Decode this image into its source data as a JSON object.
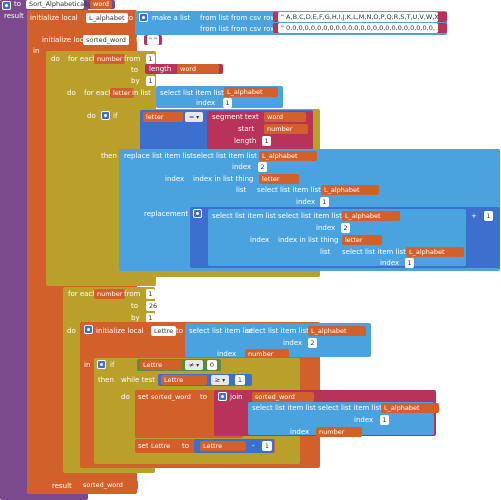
{
  "proc": {
    "to": "to",
    "name": "Sort_Alphabetically",
    "param": "word",
    "result": "result"
  },
  "init1": {
    "label": "initialize local",
    "var1": "L_alphabet",
    "to": "to",
    "make_list": "make a list",
    "from_csv": "from list from csv row  text",
    "csv_letters": "\" A,B,C,D,E,F,G,H,I,J,K,L,M,N,O,P,Q,R,S,T,U,V,W,X, ... \"",
    "csv_zeros": "\" 0,0,0,0,0,0,0,0,0,0,0,0,0,0,0,0,0,0,0,0,0,0,0,0, ... \"",
    "var2": "sorted_word",
    "empty": "\" \""
  },
  "in": "in",
  "do": "do",
  "loop1": {
    "for_each": "for each",
    "var": "number",
    "from": "from",
    "from_val": "1",
    "to": "to",
    "length": "length",
    "get": "get",
    "get_word": "word",
    "by": "by",
    "by_val": "1"
  },
  "loop2": {
    "for_each": "for each",
    "var": "letter",
    "in_list": "in list",
    "select": "select list item  list",
    "get_alpha": "L_alphabet",
    "index": "index",
    "idx": "1"
  },
  "if1": {
    "if": "if",
    "get_letter": "letter",
    "op": "=",
    "segment": "segment  text",
    "get_word": "word",
    "start": "start",
    "get_number": "number",
    "length": "length",
    "len": "1"
  },
  "then1": {
    "then": "then",
    "replace": "replace list item  list",
    "select": "select list item  list",
    "get_alpha": "L_alphabet",
    "index": "index",
    "two": "2",
    "index_in_list": "index in list  thing",
    "get_letter": "letter",
    "list": "list",
    "one": "1",
    "replacement": "replacement",
    "plus": "+"
  },
  "loop3": {
    "for_each": "for each",
    "var": "number",
    "from": "from",
    "from_val": "1",
    "to": "to",
    "to_val": "26",
    "by": "by",
    "by_val": "1"
  },
  "init2": {
    "label": "initialize local",
    "var": "Lettre",
    "to": "to",
    "select": "select list item  list",
    "get_alpha": "L_alphabet",
    "index": "index",
    "two": "2",
    "get_number": "number"
  },
  "if2": {
    "if": "if",
    "get_lettre": "Lettre",
    "neq": "≠",
    "zero": "0"
  },
  "then2": {
    "then": "then",
    "while": "while  test",
    "ge": "≥",
    "one": "1",
    "do": "do",
    "set": "set",
    "sorted_word": "sorted_word",
    "to": "to",
    "join": "join",
    "get_sorted": "sorted_word",
    "select": "select list item  list",
    "get_alpha": "L_alphabet",
    "index": "index",
    "get_number": "number",
    "one2": "1",
    "set_lettre": "Lettre",
    "minus": "-"
  },
  "result": {
    "label": "result",
    "get_sorted": "sorted_word"
  },
  "get": "get",
  "colors": {
    "proc": "#7b4a8c",
    "var": "#d2602a",
    "control": "#b8a02b",
    "list": "#4aa3df",
    "text": "#b8325a",
    "math": "#3d6fcf",
    "logic": "#5a8c3a"
  }
}
